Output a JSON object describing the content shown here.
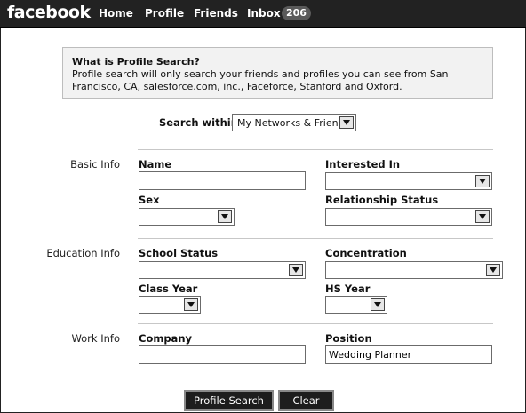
{
  "topbar": {
    "logo": "facebook",
    "nav": [
      "Home",
      "Profile",
      "Friends",
      "Inbox"
    ],
    "inbox_count": "206"
  },
  "info": {
    "title": "What is Profile Search?",
    "description": "Profile search will only search your friends and profiles you can see from San Francisco, CA, salesforce.com, inc., Faceforce, Stanford and Oxford."
  },
  "search_within": {
    "label": "Search within",
    "selected": "My Networks & Friends"
  },
  "basic_info": {
    "section": "Basic Info",
    "name_label": "Name",
    "name_value": "",
    "interested_label": "Interested In",
    "interested_value": "",
    "sex_label": "Sex",
    "sex_value": "",
    "relationship_label": "Relationship Status",
    "relationship_value": ""
  },
  "education_info": {
    "section": "Education Info",
    "school_status_label": "School Status",
    "school_status_value": "",
    "concentration_label": "Concentration",
    "concentration_value": "",
    "class_year_label": "Class Year",
    "class_year_value": "",
    "hs_year_label": "HS Year",
    "hs_year_value": ""
  },
  "work_info": {
    "section": "Work Info",
    "company_label": "Company",
    "company_value": "",
    "position_label": "Position",
    "position_value": "Wedding Planner"
  },
  "buttons": {
    "search": "Profile Search",
    "clear": "Clear"
  }
}
